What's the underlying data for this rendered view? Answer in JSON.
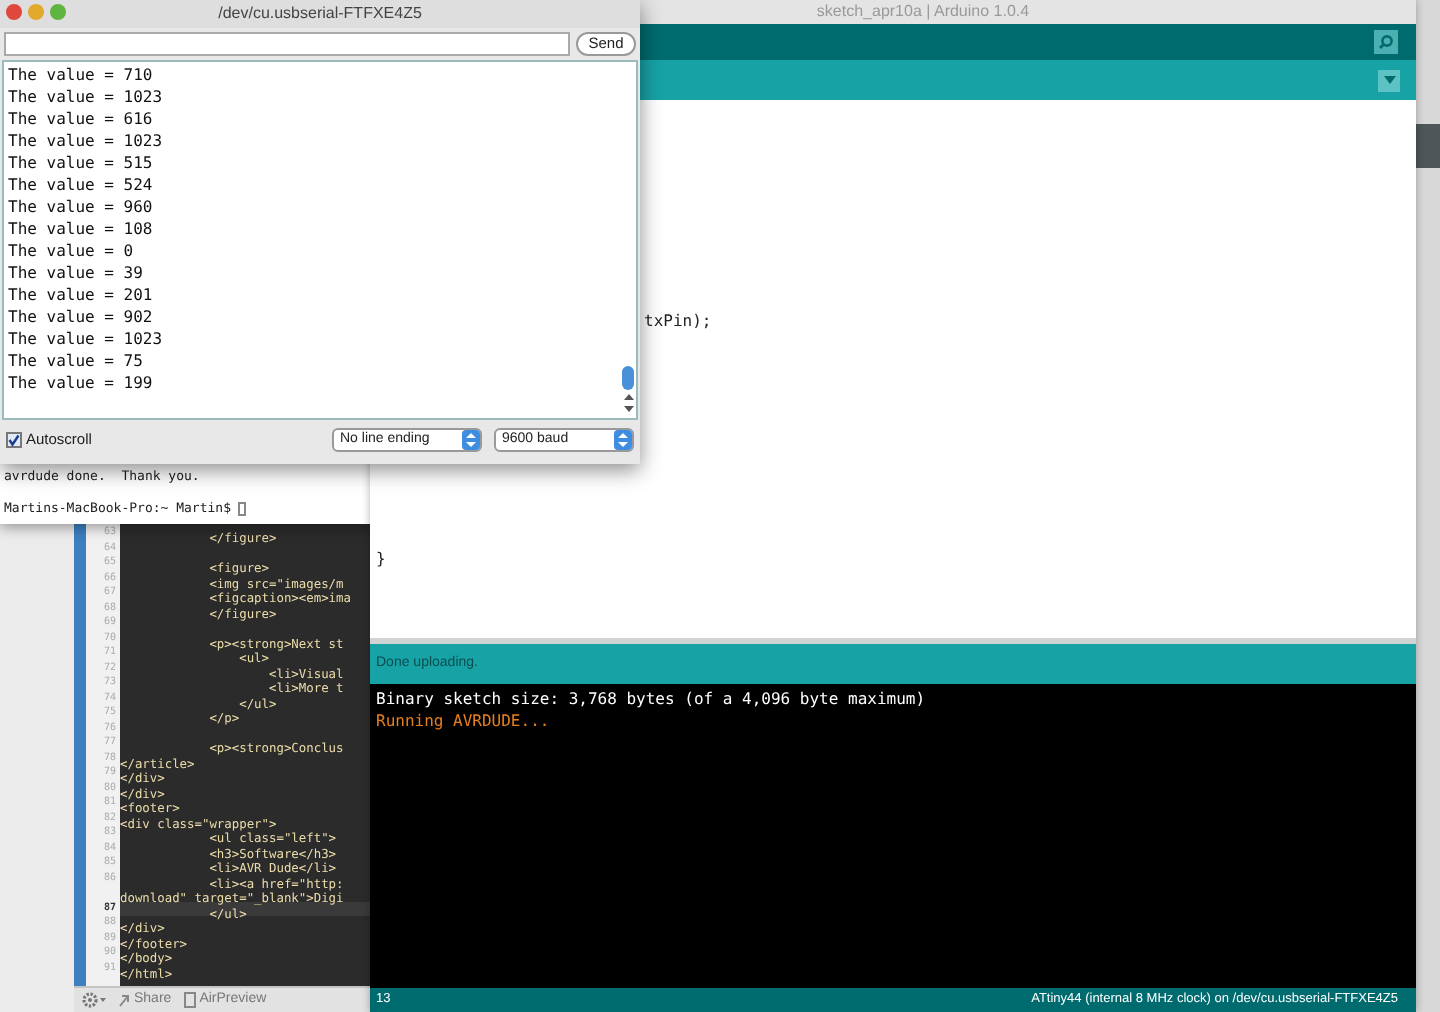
{
  "code_editor": {
    "lines": [
      {
        "number": "63",
        "text": "            </figure>",
        "current": false
      },
      {
        "number": "64",
        "current": false
      },
      {
        "number": "65",
        "text": "            <figure>",
        "current": false
      },
      {
        "number": "66",
        "text": "            <img src=\"images/m",
        "current": false
      },
      {
        "number": "67",
        "text": "            <figcaption><em>ima",
        "current": false
      },
      {
        "number": "68",
        "text": "            </figure>",
        "current": false
      },
      {
        "number": "69",
        "current": false
      },
      {
        "number": "70",
        "text": "            <p><strong>Next st",
        "current": false
      },
      {
        "number": "71",
        "text": "                <ul>",
        "current": false
      },
      {
        "number": "72",
        "text": "                    <li>Visual",
        "current": false
      },
      {
        "number": "73",
        "text": "                    <li>More t",
        "current": false
      },
      {
        "number": "74",
        "text": "                </ul>",
        "current": false
      },
      {
        "number": "75",
        "text": "            </p>",
        "current": false
      },
      {
        "number": "76",
        "current": false
      },
      {
        "number": "77",
        "text": "            <p><strong>Conclus",
        "current": false
      },
      {
        "number": "78",
        "text": "</article>",
        "current": false
      },
      {
        "number": "79",
        "text": "</div>",
        "current": false
      },
      {
        "number": "80",
        "text": "</div>",
        "current": false
      },
      {
        "number": "81",
        "text": "<footer>",
        "current": false
      },
      {
        "number": "82",
        "text": "<div class=\"wrapper\">",
        "current": false
      },
      {
        "number": "83",
        "text": "            <ul class=\"left\">",
        "current": false
      },
      {
        "number": "84",
        "text": "            <h3>Software</h3>",
        "current": false
      },
      {
        "number": "85",
        "text": "            <li>AVR Dude</li>",
        "current": false
      },
      {
        "number": "86",
        "text": "            <li><a href=\"http:",
        "current": false
      },
      {
        "text": "download\" target=\"_blank\">Digi",
        "current": false
      },
      {
        "number": "87",
        "text": "            </ul>",
        "current": true
      },
      {
        "number": "88",
        "text": "</div>",
        "current": false
      },
      {
        "number": "89",
        "text": "</footer>",
        "current": false
      },
      {
        "number": "90",
        "text": "</body>",
        "current": false
      },
      {
        "number": "91",
        "text": "</html>",
        "current": false
      }
    ],
    "toolbar": [
      "Share",
      "AirPreview"
    ]
  },
  "arduino": {
    "title": "sketch_apr10a | Arduino 1.0.4",
    "editor_lines": [
      "txPin);",
      "}"
    ],
    "status": "Done uploading.",
    "console": [
      {
        "kind": "info",
        "text": "Binary sketch size: 3,768 bytes (of a 4,096 byte maximum)"
      },
      {
        "kind": "progress",
        "text": "Running AVRDUDE..."
      }
    ],
    "line_number": "13",
    "board": "ATtiny44 (internal 8 MHz clock) on /dev/cu.usbserial-FTFXE4Z5"
  },
  "terminal": {
    "lines": [
      "avrdude done.  Thank you.",
      "Martins-MacBook-Pro:~ Martin$"
    ]
  },
  "serial_monitor": {
    "title": "/dev/cu.usbserial-FTFXE4Z5",
    "send": "Send",
    "lines": [
      "The value = 710",
      "The value = 1023",
      "The value = 616",
      "The value = 1023",
      "The value = 515",
      "The value = 524",
      "The value = 960",
      "The value = 108",
      "The value = 0",
      "The value = 39",
      "The value = 201",
      "The value = 902",
      "The value = 1023",
      "The value = 75",
      "The value = 199"
    ],
    "autoscroll": {
      "label": "Autoscroll",
      "checked": true
    },
    "line_ending": "No line ending",
    "baud": "9600 baud"
  }
}
